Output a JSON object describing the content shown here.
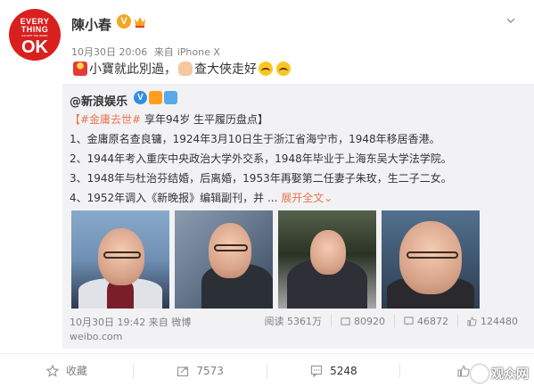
{
  "post": {
    "author": "陳小春",
    "avatar_text": [
      "EVERY",
      "THING",
      "EXCEPT THE WORD",
      "OK"
    ],
    "timestamp": "10月30日 20:06",
    "source_prefix": "来自",
    "source": "iPhone X",
    "text_1": "小寶就此別過，",
    "text_2": "查大俠走好"
  },
  "retweet": {
    "user": "@新浪娱乐",
    "lines": [
      {
        "hashtag": "【#金庸去世#",
        "rest": " 享年94岁 生平履历盘点】"
      },
      {
        "text": "1、金庸原名查良镛，1924年3月10日生于浙江省海宁市，1948年移居香港。"
      },
      {
        "text": "2、1944年考入重庆中央政治大学外交系，1948年毕业于上海东吴大学法学院。"
      },
      {
        "text": "3、1948年与杜治芬结婚，后离婚，1953年再娶第二任妻子朱玫，生二子二女。"
      },
      {
        "text": "4、1952年调入《新晚报》编辑副刊，并 ...",
        "expand": "展开全文"
      }
    ],
    "expand_arrow": "⌄",
    "footer_time": "10月30日 19:42",
    "footer_source_prefix": "来自",
    "footer_source": "微博",
    "domain": "weibo.com",
    "stats": {
      "reads_label": "阅读",
      "reads": "5361万",
      "reposts": "80920",
      "comments": "46872",
      "likes": "124480"
    }
  },
  "actions": {
    "favorite": "收藏",
    "repost": "7573",
    "comment": "5248"
  },
  "watermark": "观众网",
  "colors": {
    "link": "#eb7350",
    "verified_gold": "#f5a623",
    "verified_blue": "#2f8ee6",
    "retweet_bg": "#f2f2f5"
  }
}
